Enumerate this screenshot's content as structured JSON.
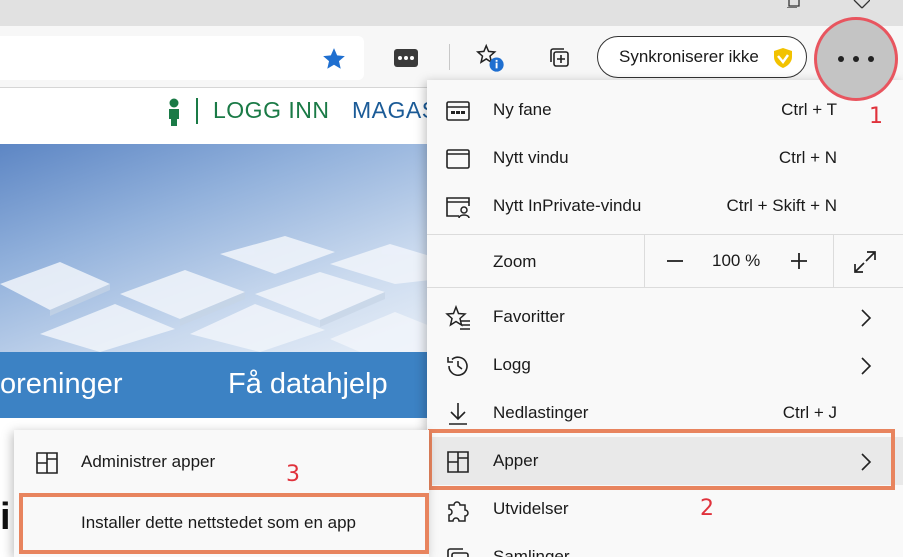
{
  "toolbar": {
    "sync_label": "Synkroniserer ikke"
  },
  "page": {
    "login_text": "LOGG INN",
    "magasin_text": "MAGAS",
    "nav_items": [
      "oreninger",
      "Få datahjelp"
    ],
    "heading_fragment": "i"
  },
  "menu": {
    "new_tab": {
      "label": "Ny fane",
      "shortcut": "Ctrl + T"
    },
    "new_window": {
      "label": "Nytt vindu",
      "shortcut": "Ctrl + N"
    },
    "new_private": {
      "label": "Nytt InPrivate-vindu",
      "shortcut": "Ctrl + Skift + N"
    },
    "zoom": {
      "label": "Zoom",
      "minus": "—",
      "value": "100 %",
      "plus": "+"
    },
    "favorites": {
      "label": "Favoritter"
    },
    "history": {
      "label": "Logg"
    },
    "downloads": {
      "label": "Nedlastinger",
      "shortcut": "Ctrl + J"
    },
    "apps": {
      "label": "Apper"
    },
    "extensions": {
      "label": "Utvidelser"
    },
    "collections": {
      "label": "Samlinger"
    }
  },
  "submenu": {
    "manage_apps": "Administrer apper",
    "install_site": "Installer dette nettstedet som en app"
  },
  "annotations": {
    "step1": "1",
    "step2": "2",
    "step3": "3",
    "highlight_color": "#e8845e",
    "circle_color": "#e8555f"
  },
  "colors": {
    "accent_blue": "#1b5b97",
    "login_green": "#1a7a46",
    "nav_blue": "#3c82c4"
  },
  "icons": {
    "favorite_star": "star-icon",
    "toolbar": [
      "password-icon",
      "favorites-info-icon",
      "collections-add-icon",
      "shield-icon"
    ],
    "menu": [
      "new-tab-icon",
      "window-icon",
      "inprivate-icon",
      "star-list-icon",
      "history-icon",
      "download-icon",
      "apps-icon",
      "puzzle-icon",
      "collections-icon"
    ]
  }
}
